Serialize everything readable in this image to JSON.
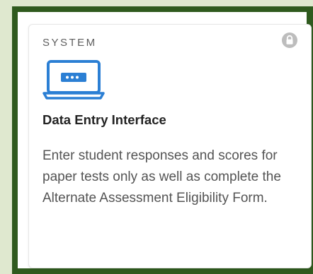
{
  "card": {
    "category": "SYSTEM",
    "title": "Data Entry Interface",
    "description": "Enter student responses and scores for paper tests only as well as complete the Alternate Assessment Eligibility Form.",
    "icon": "laptop-data-entry-icon",
    "status_icon": "lock-icon"
  },
  "colors": {
    "frame_border": "#2f5a1e",
    "page_background": "#dfe8cf",
    "accent_blue": "#2b7fd4",
    "lock_gray": "#bdbdbd"
  }
}
